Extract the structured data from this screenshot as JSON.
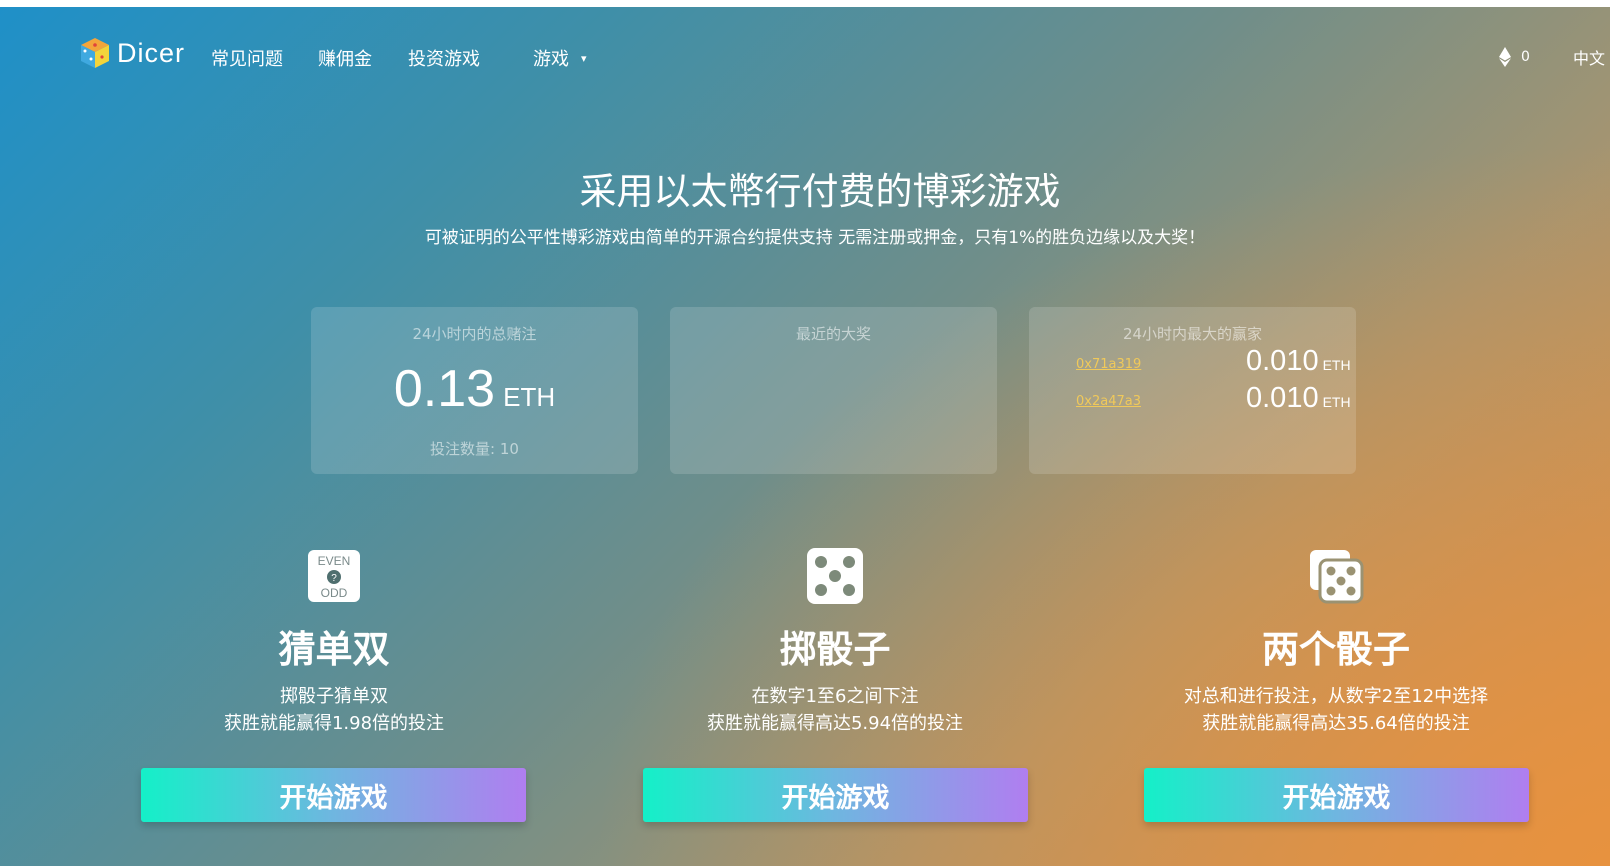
{
  "brand": {
    "name": "Dicer"
  },
  "nav": {
    "faq": "常见问题",
    "commission": "赚佣金",
    "invest": "投资游戏",
    "games": "游戏",
    "games_caret": "▾",
    "eth_balance": "0",
    "language": "中文"
  },
  "hero": {
    "title": "采用以太幣行付费的博彩游戏",
    "subtitle": "可被证明的公平性博彩游戏由简单的开源合约提供支持 无需注册或押金，只有1%的胜负边缘以及大奖！"
  },
  "stats": {
    "total": {
      "title": "24小时内的总赌注",
      "value": "0.13",
      "unit": "ETH",
      "count_label": "投注数量: 10"
    },
    "jackpot": {
      "title": "最近的大奖"
    },
    "winners": {
      "title": "24小时内最大的赢家",
      "rows": [
        {
          "address": "0x71a319",
          "value": "0.010",
          "unit": "ETH"
        },
        {
          "address": "0x2a47a3",
          "value": "0.010",
          "unit": "ETH"
        }
      ]
    }
  },
  "games": [
    {
      "icon": "even-odd-icon",
      "icon_text": {
        "top": "EVEN",
        "mid": "?",
        "bottom": "ODD"
      },
      "name": "猜单双",
      "line1": "掷骰子猜单双",
      "line2": "获胜就能赢得1.98倍的投注",
      "button": "开始游戏"
    },
    {
      "icon": "dice-icon",
      "name": "掷骰子",
      "line1": "在数字1至6之间下注",
      "line2": "获胜就能赢得高达5.94倍的投注",
      "button": "开始游戏"
    },
    {
      "icon": "two-dice-icon",
      "name": "两个骰子",
      "line1": "对总和进行投注，从数字2至12中选择",
      "line2": "获胜就能赢得高达35.64倍的投注",
      "button": "开始游戏"
    }
  ],
  "colors": {
    "gradient_start": "#1f90c8",
    "gradient_end": "#d8914d",
    "button_start": "#14f0c8",
    "button_end": "#b07ef0",
    "winner_link": "#f0c95a"
  }
}
